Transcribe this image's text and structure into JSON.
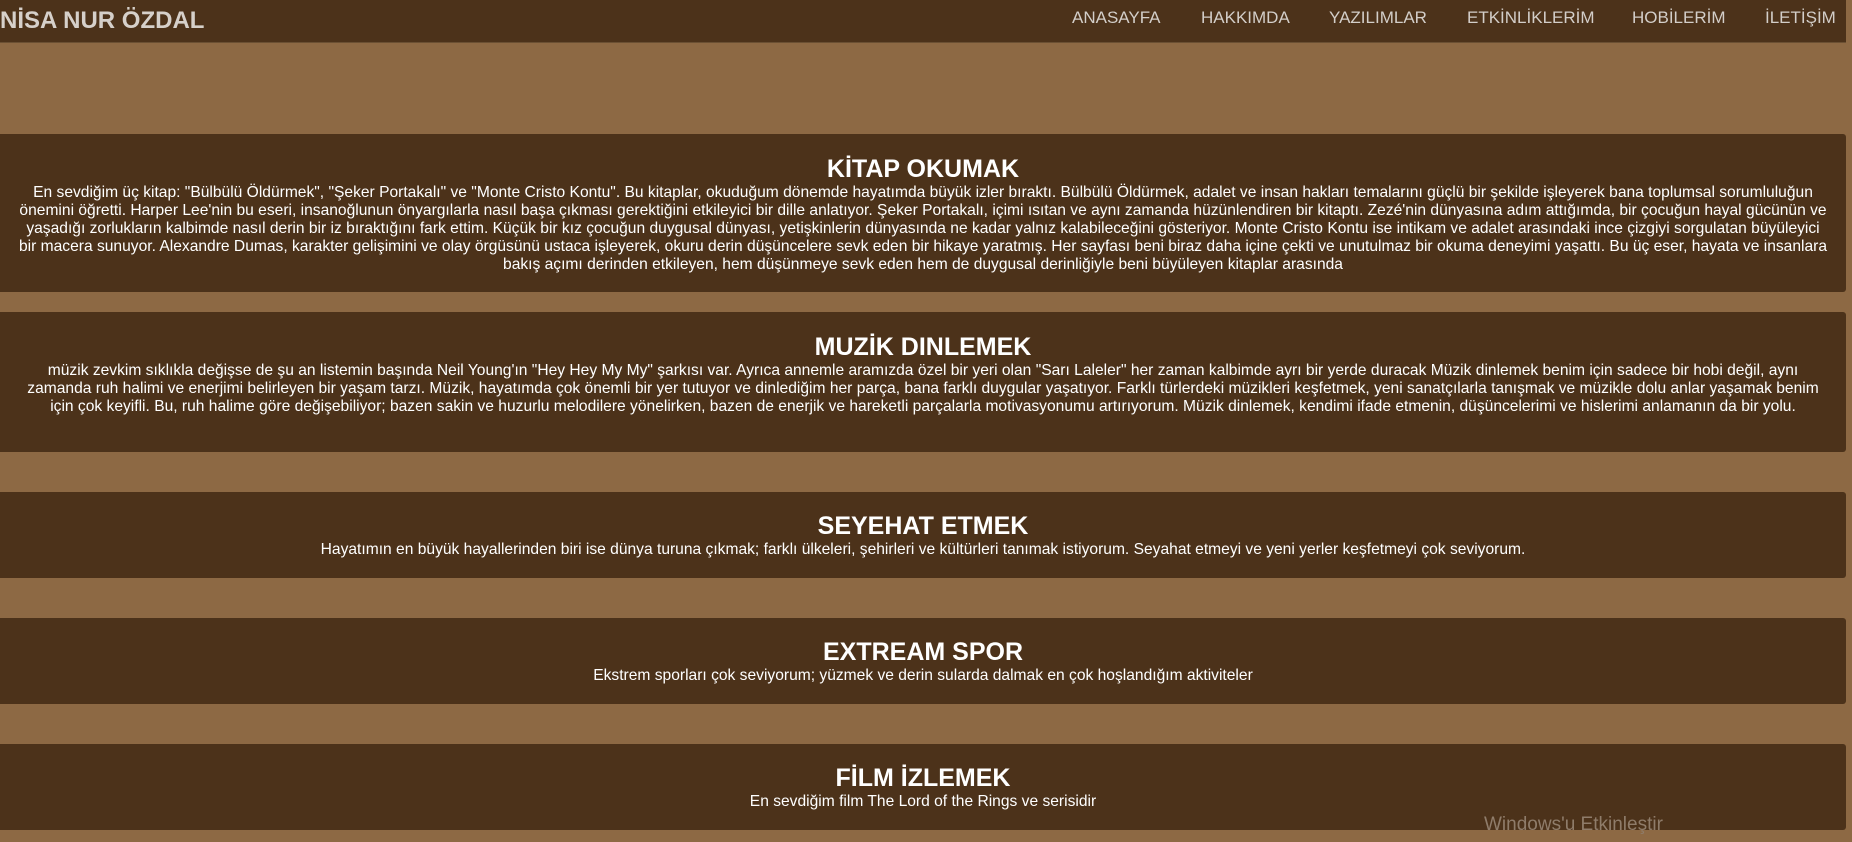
{
  "header": {
    "brand": "NİSA NUR ÖZDAL",
    "nav": [
      "ANASAYFA",
      "HAKKIMDA",
      "YAZILIMLAR",
      "ETKİNLİKLERİM",
      "HOBİLERİM",
      "İLETİŞİM"
    ]
  },
  "sections": [
    {
      "title": "KİTAP OKUMAK",
      "text": "En sevdiğim üç kitap: \"Bülbülü Öldürmek\", \"Şeker Portakalı\" ve \"Monte Cristo Kontu\". Bu kitaplar, okuduğum dönemde hayatımda büyük izler bıraktı. Bülbülü Öldürmek, adalet ve insan hakları temalarını güçlü bir şekilde işleyerek bana toplumsal sorumluluğun önemini öğretti. Harper Lee'nin bu eseri, insanoğlunun önyargılarla nasıl başa çıkması gerektiğini etkileyici bir dille anlatıyor. Şeker Portakalı, içimi ısıtan ve aynı zamanda hüzünlendiren bir kitaptı. Zezé'nin dünyasına adım attığımda, bir çocuğun hayal gücünün ve yaşadığı zorlukların kalbimde nasıl derin bir iz bıraktığını fark ettim. Küçük bir kız çocuğun duygusal dünyası, yetişkinlerin dünyasında ne kadar yalnız kalabileceğini gösteriyor. Monte Cristo Kontu ise intikam ve adalet arasındaki ince çizgiyi sorgulatan büyüleyici bir macera sunuyor. Alexandre Dumas, karakter gelişimini ve olay örgüsünü ustaca işleyerek, okuru derin düşüncelere sevk eden bir hikaye yaratmış. Her sayfası beni biraz daha içine çekti ve unutulmaz bir okuma deneyimi yaşattı. Bu üç eser, hayata ve insanlara bakış açımı derinden etkileyen, hem düşünmeye sevk eden hem de duygusal derinliğiyle beni büyüleyen kitaplar arasında"
    },
    {
      "title": "MUZİK DINLEMEK",
      "text": "müzik zevkim sıklıkla değişse de şu an listemin başında Neil Young'ın \"Hey Hey My My\" şarkısı var. Ayrıca annemle aramızda özel bir yeri olan \"Sarı Laleler\" her zaman kalbimde ayrı bir yerde duracak Müzik dinlemek benim için sadece bir hobi değil, aynı zamanda ruh halimi ve enerjimi belirleyen bir yaşam tarzı. Müzik, hayatımda çok önemli bir yer tutuyor ve dinlediğim her parça, bana farklı duygular yaşatıyor. Farklı türlerdeki müzikleri keşfetmek, yeni sanatçılarla tanışmak ve müzikle dolu anlar yaşamak benim için çok keyifli. Bu, ruh halime göre değişebiliyor; bazen sakin ve huzurlu melodilere yönelirken, bazen de enerjik ve hareketli parçalarla motivasyonumu artırıyorum. Müzik dinlemek, kendimi ifade etmenin, düşüncelerimi ve hislerimi anlamanın da bir yolu."
    },
    {
      "title": "SEYEHAT ETMEK",
      "text": "Hayatımın en büyük hayallerinden biri ise dünya turuna çıkmak; farklı ülkeleri, şehirleri ve kültürleri tanımak istiyorum. Seyahat etmeyi ve yeni yerler keşfetmeyi çok seviyorum."
    },
    {
      "title": "EXTREAM SPOR",
      "text": "Ekstrem sporları çok seviyorum; yüzmek ve derin sularda dalmak en çok hoşlandığım aktiviteler"
    },
    {
      "title": "FİLM İZLEMEK",
      "text": "En sevdiğim film The Lord of the Rings ve serisidir"
    }
  ],
  "overlay": {
    "watermark": "Windows'u Etkinleştir"
  }
}
